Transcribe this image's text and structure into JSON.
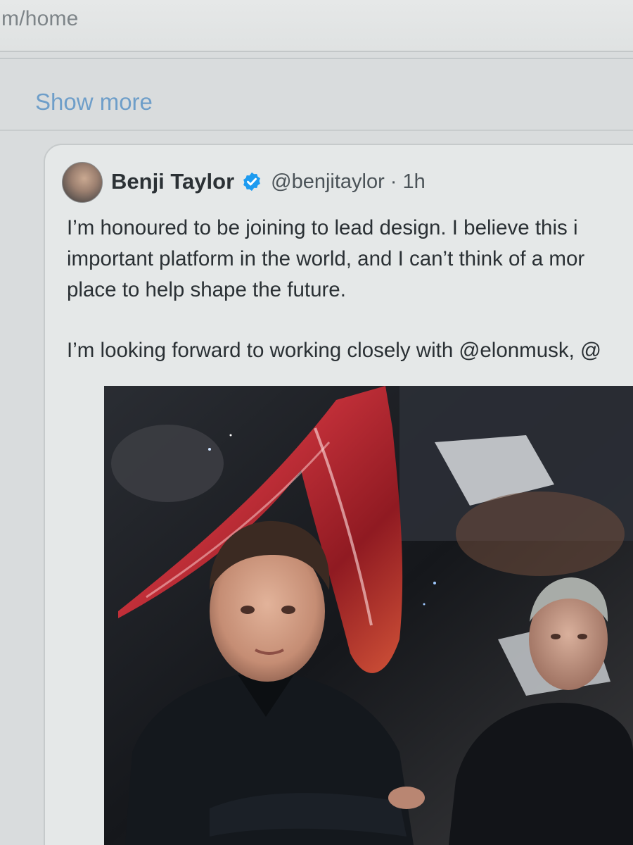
{
  "browser": {
    "address_text": "m/home"
  },
  "feed": {
    "show_more_label": "Show more"
  },
  "tweet": {
    "author_name": "Benji Taylor",
    "verified_icon": "verified-badge-icon",
    "handle": "@benjitaylor",
    "separator": "·",
    "time": "1h",
    "text_lines": [
      "I’m honoured to be joining    to lead design. I believe this i",
      "important platform in the world, and I can’t think of a mor",
      "place to help shape the future.",
      "I’m looking forward to working closely with @elonmusk, @"
    ]
  },
  "colors": {
    "link_blue": "#6e9ec9",
    "verified_blue": "#1d9bf0",
    "text_dark": "#2a3034",
    "text_muted": "#4b5358"
  }
}
